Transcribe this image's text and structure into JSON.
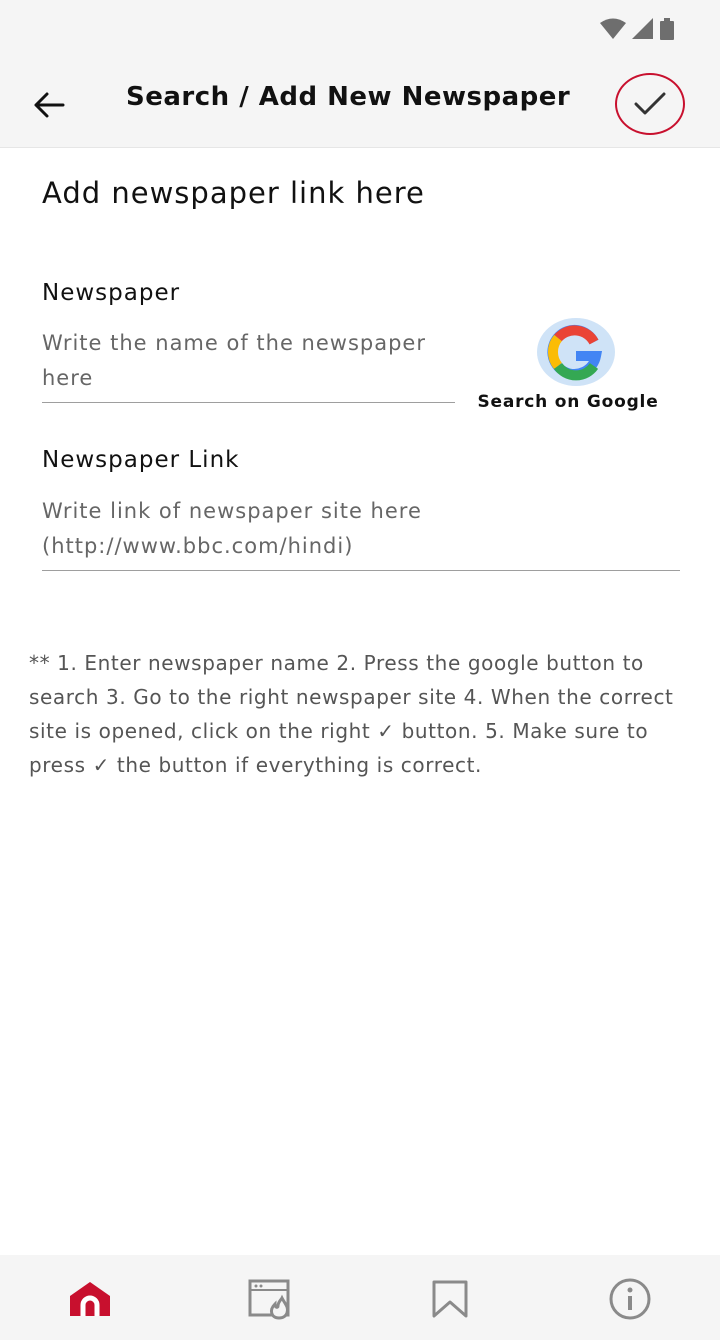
{
  "header": {
    "title": "Search / Add New Newspaper",
    "back_icon": "arrow-left-icon",
    "confirm_icon": "check-icon"
  },
  "form": {
    "heading": "Add newspaper link here",
    "newspaper": {
      "label": "Newspaper",
      "placeholder": "Write the name of the newspaper here"
    },
    "link": {
      "label": "Newspaper Link",
      "placeholder": "Write link of newspaper site here (http://www.bbc.com/hindi)"
    },
    "google_button": {
      "label": "Search on Google",
      "icon": "google-icon"
    }
  },
  "instructions": "** 1. Enter newspaper name 2. Press the google button to search 3. Go to the right newspaper site 4. When the correct site is opened, click on the right ✓ button. 5. Make sure to press ✓ the button if everything is correct.",
  "bottom_nav": [
    {
      "name": "home",
      "icon": "home-icon",
      "active": true
    },
    {
      "name": "trending",
      "icon": "trending-icon",
      "active": false
    },
    {
      "name": "bookmarks",
      "icon": "bookmark-icon",
      "active": false
    },
    {
      "name": "info",
      "icon": "info-icon",
      "active": false
    }
  ],
  "colors": {
    "accent": "#c8102e",
    "bar_background": "#f5f5f5",
    "inactive_icon": "#8a8a8a"
  }
}
